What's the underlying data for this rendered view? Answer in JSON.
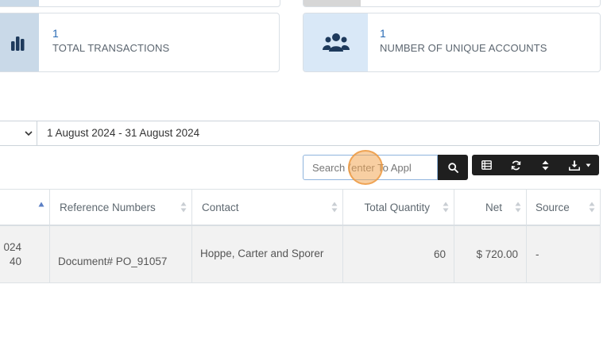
{
  "stats": {
    "transactions": {
      "value": "1",
      "label": "TOTAL TRANSACTIONS",
      "icon": "bar-chart-icon"
    },
    "accounts": {
      "value": "1",
      "label": "NUMBER OF UNIQUE ACCOUNTS",
      "icon": "users-icon"
    }
  },
  "filters": {
    "date_range": "1 August 2024 - 31 August 2024"
  },
  "search": {
    "placeholder": "Search (enter To Appl"
  },
  "toolbar": {
    "buttons": [
      "list-icon",
      "refresh-icon",
      "sort-icon",
      "download-icon"
    ]
  },
  "table": {
    "columns": [
      "Reference Numbers",
      "Contact",
      "Total Quantity",
      "Net",
      "Source"
    ],
    "rows": [
      {
        "date_line1": "024",
        "date_line2": "40",
        "reference": "Document# PO_91057",
        "contact": "Hoppe, Carter and Sporer",
        "quantity": "60",
        "net": "$ 720.00",
        "source": "-"
      }
    ]
  },
  "colors": {
    "accent": "#2a6bb5",
    "toolbar_bg": "#1f1f1f",
    "icon_bg_left": "#c9d9e8",
    "icon_bg_right": "#d9e8f7",
    "icon_color": "#1e3a5c"
  }
}
